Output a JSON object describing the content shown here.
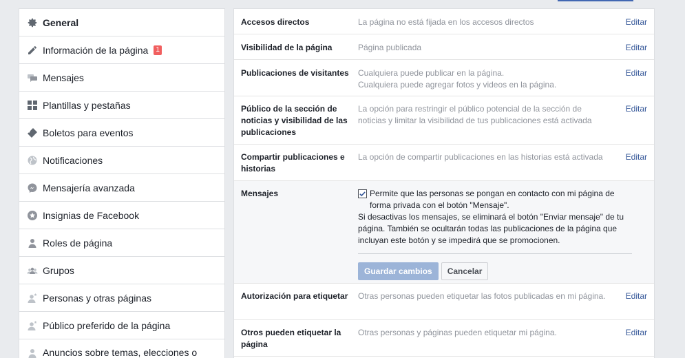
{
  "sidebar": {
    "items": [
      {
        "label": "General",
        "icon": "gear-icon"
      },
      {
        "label": "Información de la página",
        "icon": "pencil-icon",
        "badge": "1"
      },
      {
        "label": "Mensajes",
        "icon": "chat-bubbles-icon"
      },
      {
        "label": "Plantillas y pestañas",
        "icon": "grid-icon"
      },
      {
        "label": "Boletos para eventos",
        "icon": "ticket-icon"
      },
      {
        "label": "Notificaciones",
        "icon": "globe-icon"
      },
      {
        "label": "Mensajería avanzada",
        "icon": "messenger-icon"
      },
      {
        "label": "Insignias de Facebook",
        "icon": "star-badge-icon"
      },
      {
        "label": "Roles de página",
        "icon": "person-icon"
      },
      {
        "label": "Grupos",
        "icon": "group-icon"
      },
      {
        "label": "Personas y otras páginas",
        "icon": "person-star-icon"
      },
      {
        "label": "Público preferido de la página",
        "icon": "person-star-icon"
      },
      {
        "label": "Anuncios sobre temas, elecciones o",
        "icon": "person-icon"
      }
    ]
  },
  "settings": {
    "edit_label": "Editar",
    "rows": [
      {
        "label": "Accesos directos",
        "value": "La página no está fijada en los accesos directos"
      },
      {
        "label": "Visibilidad de la página",
        "value": "Página publicada"
      },
      {
        "label": "Publicaciones de visitantes",
        "value_lines": [
          "Cualquiera puede publicar en la página.",
          "Cualquiera puede agregar fotos y videos en la página."
        ]
      },
      {
        "label": "Público de la sección de noticias y visibilidad de las publicaciones",
        "value": "La opción para restringir el público potencial de la sección de noticias y limitar la visibilidad de tus publicaciones está activada"
      },
      {
        "label": "Compartir publicaciones e historias",
        "value": "La opción de compartir publicaciones en las historias está activada"
      },
      {
        "label": "Autorización para etiquetar",
        "value": "Otras personas pueden etiquetar las fotos publicadas en mi página."
      },
      {
        "label": "Otros pueden etiquetar la página",
        "value": "Otras personas y páginas pueden etiquetar mi página."
      }
    ],
    "mensajes": {
      "label": "Mensajes",
      "checkbox_label": "Permite que las personas se pongan en contacto con mi página de forma privada con el botón \"Mensaje\".",
      "checked": true,
      "note": "Si desactivas los mensajes, se eliminará el botón \"Enviar mensaje\" de tu página. También se ocultarán todas las publicaciones de la página que incluyan este botón y se impedirá que se promocionen.",
      "save_label": "Guardar cambios",
      "cancel_label": "Cancelar"
    }
  },
  "colors": {
    "link": "#365899",
    "badge": "#f15f5f",
    "primary_disabled": "#9cb4d8"
  }
}
